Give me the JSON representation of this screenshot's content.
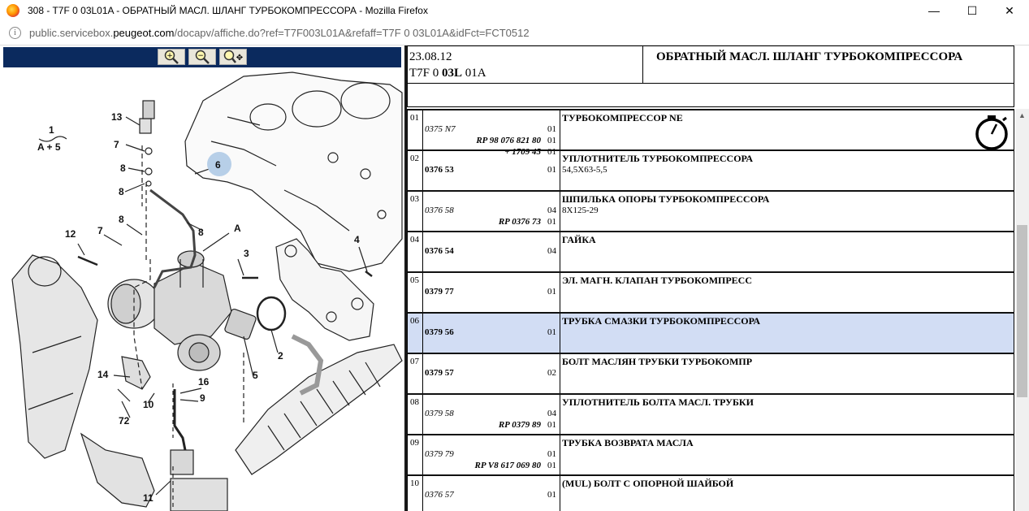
{
  "window": {
    "title": "308 - T7F 0 03L01A - ОБРАТНЫЙ МАСЛ. ШЛАНГ ТУРБОКОМПРЕССОРА - Mozilla Firefox",
    "minimize": "—",
    "maximize": "☐",
    "close": "✕"
  },
  "url": {
    "prefix": "public.servicebox.",
    "domain": "peugeot.com",
    "suffix": "/docapv/affiche.do?ref=T7F003L01A&refaff=T7F 0 03L01A&idFct=FCT0512"
  },
  "zoom": {
    "zoom_in": "+",
    "zoom_out": "−",
    "zoom_fit": "✥"
  },
  "diagram": {
    "labels": [
      {
        "id": "l13",
        "text": "13"
      },
      {
        "id": "l7a",
        "text": "7"
      },
      {
        "id": "l8a",
        "text": "8"
      },
      {
        "id": "l8b",
        "text": "8"
      },
      {
        "id": "l6",
        "text": "6"
      },
      {
        "id": "l1",
        "text": "1"
      },
      {
        "id": "lA5",
        "text": "A + 5"
      },
      {
        "id": "l8c",
        "text": "8"
      },
      {
        "id": "l7b",
        "text": "7"
      },
      {
        "id": "l8d",
        "text": "8"
      },
      {
        "id": "lA",
        "text": "A"
      },
      {
        "id": "l12",
        "text": "12"
      },
      {
        "id": "l3",
        "text": "3"
      },
      {
        "id": "l4",
        "text": "4"
      },
      {
        "id": "l2",
        "text": "2"
      },
      {
        "id": "l5",
        "text": "5"
      },
      {
        "id": "l14",
        "text": "14"
      },
      {
        "id": "l10",
        "text": "10"
      },
      {
        "id": "l16",
        "text": "16"
      },
      {
        "id": "l9",
        "text": "9"
      },
      {
        "id": "l72",
        "text": "72"
      },
      {
        "id": "l11",
        "text": "11"
      }
    ]
  },
  "header": {
    "date": "23.08.12",
    "ref_a": "T7F 0 ",
    "ref_b": "03L",
    "ref_c": " 01A",
    "title": "ОБРАТНЫЙ МАСЛ. ШЛАНГ ТУРБОКОМПРЕССОРА"
  },
  "rows": [
    {
      "num": "01",
      "p1": "0375 N7",
      "p1_style": "i",
      "q1": "01",
      "p2": "RP 98 076 821 80",
      "q2": "01",
      "p3": "+ 1709 45",
      "q3": "01",
      "d1": "ТУРБОКОМПРЕССОР NE",
      "d2": ""
    },
    {
      "num": "02",
      "p1": "0376 53",
      "p1_style": "b",
      "q1": "01",
      "p2": "",
      "q2": "",
      "p3": "",
      "q3": "",
      "d1": "УПЛОТНИТЕЛЬ ТУРБОКОМПРЕССОРА",
      "d2": "54,5X63-5,5"
    },
    {
      "num": "03",
      "p1": "0376 58",
      "p1_style": "i",
      "q1": "04",
      "p2": "RP 0376 73",
      "q2": "01",
      "p3": "",
      "q3": "",
      "d1": "ШПИЛЬКА ОПОРЫ ТУРБОКОМПРЕССОРА",
      "d2": "8X125-29"
    },
    {
      "num": "04",
      "p1": "0376 54",
      "p1_style": "b",
      "q1": "04",
      "p2": "",
      "q2": "",
      "p3": "",
      "q3": "",
      "d1": "ГАЙКА",
      "d2": ""
    },
    {
      "num": "05",
      "p1": "0379 77",
      "p1_style": "b",
      "q1": "01",
      "p2": "",
      "q2": "",
      "p3": "",
      "q3": "",
      "d1": "ЭЛ. МАГН. КЛАПАН ТУРБОКОМПРЕСС",
      "d2": ""
    },
    {
      "num": "06",
      "p1": "0379 56",
      "p1_style": "b",
      "q1": "01",
      "p2": "",
      "q2": "",
      "p3": "",
      "q3": "",
      "d1": "ТРУБКА СМАЗКИ ТУРБОКОМПРЕССОРА",
      "d2": ""
    },
    {
      "num": "07",
      "p1": "0379 57",
      "p1_style": "b",
      "q1": "02",
      "p2": "",
      "q2": "",
      "p3": "",
      "q3": "",
      "d1": "БОЛТ МАСЛЯН ТРУБКИ ТУРБОКОМПР",
      "d2": ""
    },
    {
      "num": "08",
      "p1": "0379 58",
      "p1_style": "i",
      "q1": "04",
      "p2": "RP 0379 89",
      "q2": "01",
      "p3": "",
      "q3": "",
      "d1": "УПЛОТНИТЕЛЬ БОЛТА МАСЛ. ТРУБКИ",
      "d2": ""
    },
    {
      "num": "09",
      "p1": "0379 79",
      "p1_style": "i",
      "q1": "01",
      "p2": "RP V8 617 069 80",
      "q2": "01",
      "p3": "",
      "q3": "",
      "d1": "ТРУБКА ВОЗВРАТА МАСЛА",
      "d2": ""
    },
    {
      "num": "10",
      "p1": "0376 57",
      "p1_style": "i",
      "q1": "01",
      "p2": "",
      "q2": "",
      "p3": "",
      "q3": "",
      "d1": "(MUL) БОЛТ С ОПОРНОЙ ШАЙБОЙ",
      "d2": ""
    }
  ],
  "selected_row": "06",
  "colors": {
    "selected_row": "#d2ddf4",
    "zoombar": "#0b2a5e"
  }
}
